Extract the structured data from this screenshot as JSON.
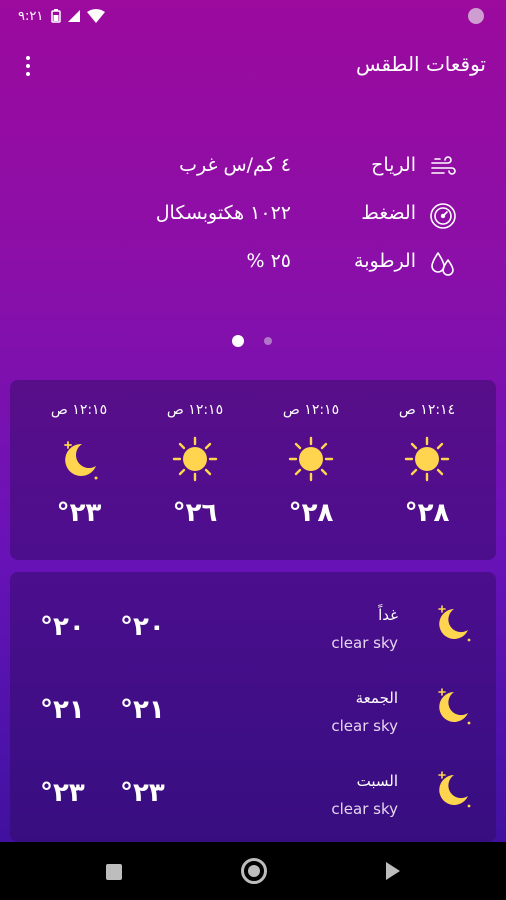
{
  "status_bar": {
    "time": "٩:٢١"
  },
  "app_bar": {
    "title": "توقعات الطقس"
  },
  "current": {
    "rows": [
      {
        "icon": "wind-icon",
        "label": "الرياح",
        "value": "٤ كم/س غرب"
      },
      {
        "icon": "pressure-gauge-icon",
        "label": "الضغط",
        "value": "١٠٢٢ هكتوبسكال"
      },
      {
        "icon": "humidity-drops-icon",
        "label": "الرطوبة",
        "value": "٢٥ %"
      }
    ]
  },
  "pager": {
    "pages": 2,
    "active": 1
  },
  "hourly": [
    {
      "time": "١٢:١٤ ص",
      "icon": "sun-icon",
      "temp": "°٢٨"
    },
    {
      "time": "١٢:١٥ ص",
      "icon": "sun-icon",
      "temp": "°٢٨"
    },
    {
      "time": "١٢:١٥ ص",
      "icon": "sun-icon",
      "temp": "°٢٦"
    },
    {
      "time": "١٢:١٥ ص",
      "icon": "crescent-moon-icon",
      "temp": "°٢٣"
    }
  ],
  "daily": [
    {
      "day": "غداً",
      "desc": "clear sky",
      "icon": "crescent-moon-icon",
      "max": "°٢٠",
      "min": "°٢٠"
    },
    {
      "day": "الجمعة",
      "desc": "clear sky",
      "icon": "crescent-moon-icon",
      "max": "°٢١",
      "min": "°٢١"
    },
    {
      "day": "السبت",
      "desc": "clear sky",
      "icon": "crescent-moon-icon",
      "max": "°٢٣",
      "min": "°٢٣"
    }
  ],
  "colors": {
    "sun": "#ffd54f",
    "moon": "#ffd54f",
    "card": "#2d0a5a"
  }
}
